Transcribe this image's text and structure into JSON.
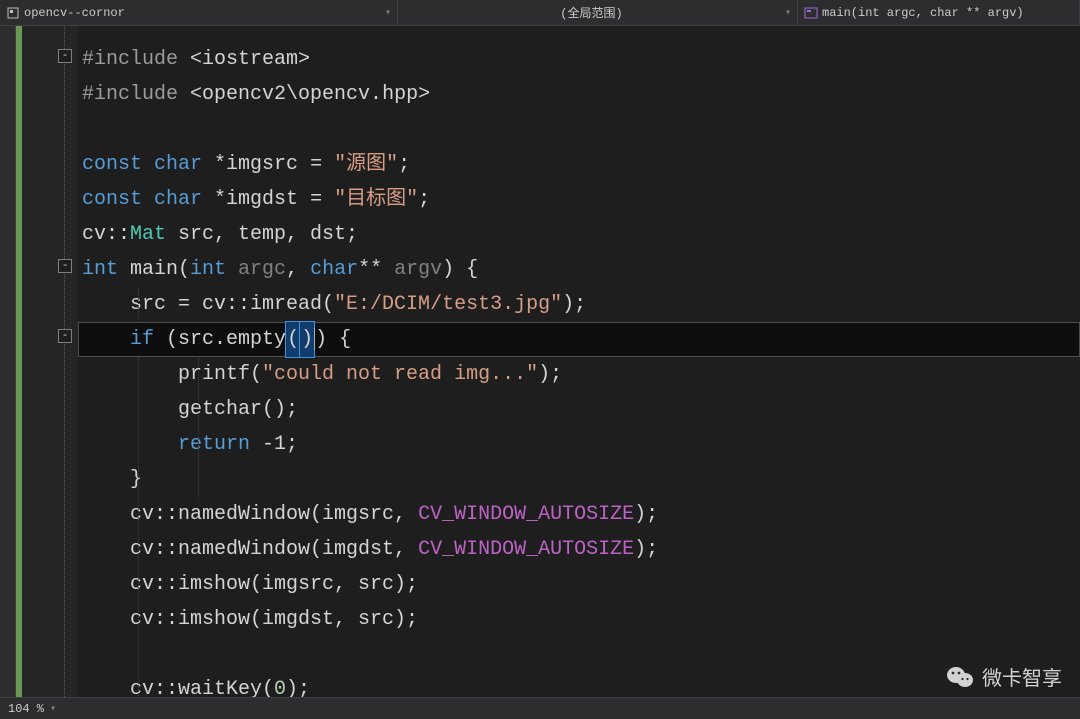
{
  "topbar": {
    "project": "opencv--cornor",
    "scope": "(全局范围)",
    "symbol": "main(int argc, char ** argv)"
  },
  "fold": {
    "minus": "-",
    "plus": "+"
  },
  "code": {
    "include_kw1": "#include",
    "include_hdr1": "<iostream>",
    "include_kw2": "#include",
    "include_hdr2": "<opencv2\\opencv.hpp>",
    "const1_kw": "const",
    "const1_type": "char",
    "const1_rest": " *imgsrc = ",
    "const1_str": "\"源图\"",
    "const1_end": ";",
    "const2_kw": "const",
    "const2_type": "char",
    "const2_rest": " *imgdst = ",
    "const2_str": "\"目标图\"",
    "const2_end": ";",
    "mat_ns": "cv::",
    "mat_type": "Mat",
    "mat_rest": " src, temp, dst;",
    "main_int": "int",
    "main_name": " main(",
    "main_int2": "int",
    "main_argc": " argc",
    "main_comma": ", ",
    "main_char": "char",
    "main_stars": "**",
    "main_argv": " argv",
    "main_close": ") {",
    "imread_pre": "    src = cv::imread(",
    "imread_str": "\"E:/DCIM/test3.jpg\"",
    "imread_end": ");",
    "if_indent": "    ",
    "if_kw": "if",
    "if_open": " (src.empty",
    "if_paren_open": "(",
    "if_paren_close": ")",
    "if_after": ") {",
    "printf_pre": "        printf(",
    "printf_str": "\"could not read img...\"",
    "printf_end": ");",
    "getchar_line": "        getchar();",
    "return_indent": "        ",
    "return_kw": "return",
    "return_rest": " -1;",
    "brace_close_inner": "    }",
    "nw1_pre": "    cv::namedWindow(imgsrc, ",
    "nw1_macro": "CV_WINDOW_AUTOSIZE",
    "nw1_end": ");",
    "nw2_pre": "    cv::namedWindow(imgdst, ",
    "nw2_macro": "CV_WINDOW_AUTOSIZE",
    "nw2_end": ");",
    "imshow1": "    cv::imshow(imgsrc, src);",
    "imshow2": "    cv::imshow(imgdst, src);",
    "waitkey_pre": "    cv::waitKey(",
    "waitkey_num": "0",
    "waitkey_end": ");"
  },
  "status": {
    "zoom": "104 %"
  },
  "watermark": {
    "text": "微卡智享"
  }
}
